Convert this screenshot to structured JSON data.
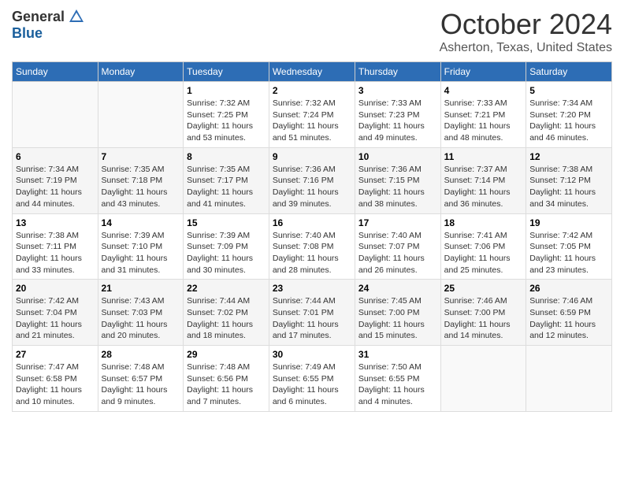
{
  "header": {
    "logo_general": "General",
    "logo_blue": "Blue",
    "month": "October 2024",
    "location": "Asherton, Texas, United States"
  },
  "days_of_week": [
    "Sunday",
    "Monday",
    "Tuesday",
    "Wednesday",
    "Thursday",
    "Friday",
    "Saturday"
  ],
  "weeks": [
    [
      {
        "day": "",
        "info": ""
      },
      {
        "day": "",
        "info": ""
      },
      {
        "day": "1",
        "info": "Sunrise: 7:32 AM\nSunset: 7:25 PM\nDaylight: 11 hours and 53 minutes."
      },
      {
        "day": "2",
        "info": "Sunrise: 7:32 AM\nSunset: 7:24 PM\nDaylight: 11 hours and 51 minutes."
      },
      {
        "day": "3",
        "info": "Sunrise: 7:33 AM\nSunset: 7:23 PM\nDaylight: 11 hours and 49 minutes."
      },
      {
        "day": "4",
        "info": "Sunrise: 7:33 AM\nSunset: 7:21 PM\nDaylight: 11 hours and 48 minutes."
      },
      {
        "day": "5",
        "info": "Sunrise: 7:34 AM\nSunset: 7:20 PM\nDaylight: 11 hours and 46 minutes."
      }
    ],
    [
      {
        "day": "6",
        "info": "Sunrise: 7:34 AM\nSunset: 7:19 PM\nDaylight: 11 hours and 44 minutes."
      },
      {
        "day": "7",
        "info": "Sunrise: 7:35 AM\nSunset: 7:18 PM\nDaylight: 11 hours and 43 minutes."
      },
      {
        "day": "8",
        "info": "Sunrise: 7:35 AM\nSunset: 7:17 PM\nDaylight: 11 hours and 41 minutes."
      },
      {
        "day": "9",
        "info": "Sunrise: 7:36 AM\nSunset: 7:16 PM\nDaylight: 11 hours and 39 minutes."
      },
      {
        "day": "10",
        "info": "Sunrise: 7:36 AM\nSunset: 7:15 PM\nDaylight: 11 hours and 38 minutes."
      },
      {
        "day": "11",
        "info": "Sunrise: 7:37 AM\nSunset: 7:14 PM\nDaylight: 11 hours and 36 minutes."
      },
      {
        "day": "12",
        "info": "Sunrise: 7:38 AM\nSunset: 7:12 PM\nDaylight: 11 hours and 34 minutes."
      }
    ],
    [
      {
        "day": "13",
        "info": "Sunrise: 7:38 AM\nSunset: 7:11 PM\nDaylight: 11 hours and 33 minutes."
      },
      {
        "day": "14",
        "info": "Sunrise: 7:39 AM\nSunset: 7:10 PM\nDaylight: 11 hours and 31 minutes."
      },
      {
        "day": "15",
        "info": "Sunrise: 7:39 AM\nSunset: 7:09 PM\nDaylight: 11 hours and 30 minutes."
      },
      {
        "day": "16",
        "info": "Sunrise: 7:40 AM\nSunset: 7:08 PM\nDaylight: 11 hours and 28 minutes."
      },
      {
        "day": "17",
        "info": "Sunrise: 7:40 AM\nSunset: 7:07 PM\nDaylight: 11 hours and 26 minutes."
      },
      {
        "day": "18",
        "info": "Sunrise: 7:41 AM\nSunset: 7:06 PM\nDaylight: 11 hours and 25 minutes."
      },
      {
        "day": "19",
        "info": "Sunrise: 7:42 AM\nSunset: 7:05 PM\nDaylight: 11 hours and 23 minutes."
      }
    ],
    [
      {
        "day": "20",
        "info": "Sunrise: 7:42 AM\nSunset: 7:04 PM\nDaylight: 11 hours and 21 minutes."
      },
      {
        "day": "21",
        "info": "Sunrise: 7:43 AM\nSunset: 7:03 PM\nDaylight: 11 hours and 20 minutes."
      },
      {
        "day": "22",
        "info": "Sunrise: 7:44 AM\nSunset: 7:02 PM\nDaylight: 11 hours and 18 minutes."
      },
      {
        "day": "23",
        "info": "Sunrise: 7:44 AM\nSunset: 7:01 PM\nDaylight: 11 hours and 17 minutes."
      },
      {
        "day": "24",
        "info": "Sunrise: 7:45 AM\nSunset: 7:00 PM\nDaylight: 11 hours and 15 minutes."
      },
      {
        "day": "25",
        "info": "Sunrise: 7:46 AM\nSunset: 7:00 PM\nDaylight: 11 hours and 14 minutes."
      },
      {
        "day": "26",
        "info": "Sunrise: 7:46 AM\nSunset: 6:59 PM\nDaylight: 11 hours and 12 minutes."
      }
    ],
    [
      {
        "day": "27",
        "info": "Sunrise: 7:47 AM\nSunset: 6:58 PM\nDaylight: 11 hours and 10 minutes."
      },
      {
        "day": "28",
        "info": "Sunrise: 7:48 AM\nSunset: 6:57 PM\nDaylight: 11 hours and 9 minutes."
      },
      {
        "day": "29",
        "info": "Sunrise: 7:48 AM\nSunset: 6:56 PM\nDaylight: 11 hours and 7 minutes."
      },
      {
        "day": "30",
        "info": "Sunrise: 7:49 AM\nSunset: 6:55 PM\nDaylight: 11 hours and 6 minutes."
      },
      {
        "day": "31",
        "info": "Sunrise: 7:50 AM\nSunset: 6:55 PM\nDaylight: 11 hours and 4 minutes."
      },
      {
        "day": "",
        "info": ""
      },
      {
        "day": "",
        "info": ""
      }
    ]
  ]
}
